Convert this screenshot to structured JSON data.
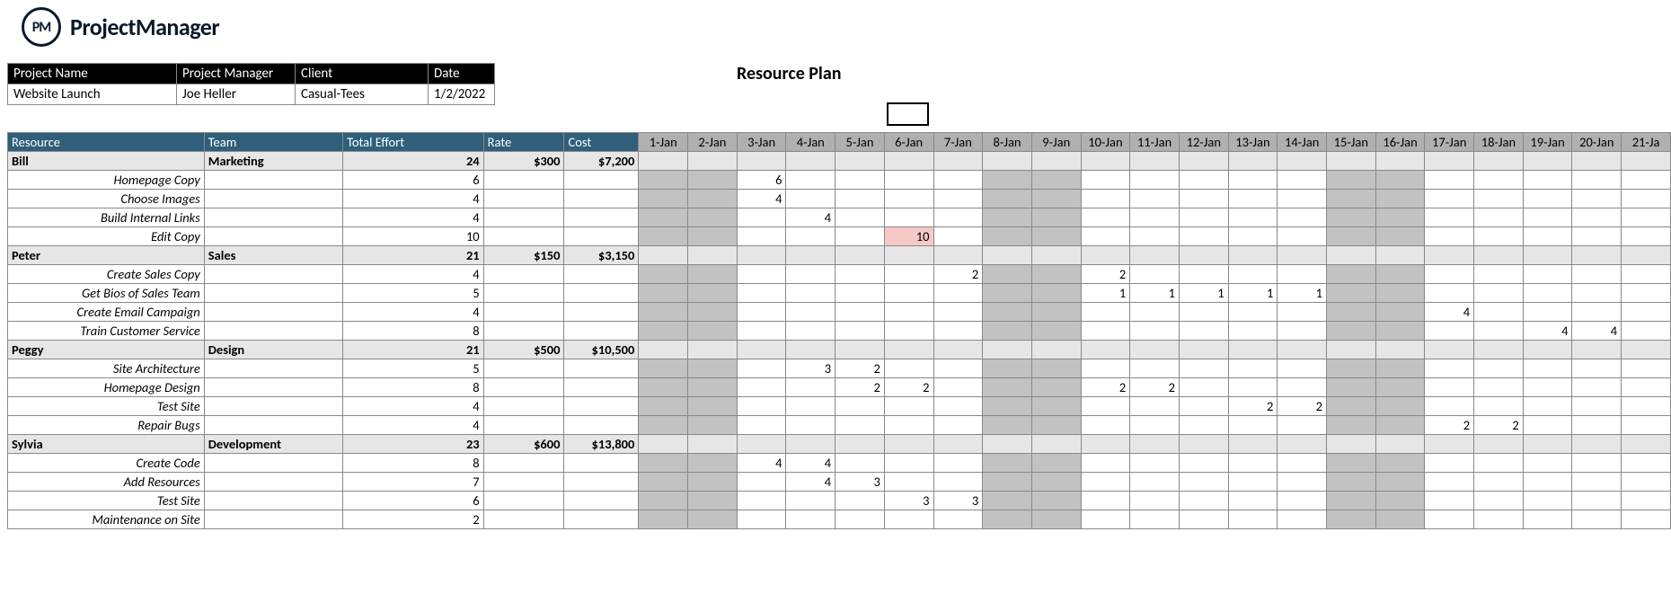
{
  "logo": {
    "badge": "PM",
    "name": "ProjectManager"
  },
  "title": "Resource Plan",
  "meta": {
    "headers": {
      "projectName": "Project Name",
      "projectManager": "Project Manager",
      "client": "Client",
      "date": "Date"
    },
    "values": {
      "projectName": "Website Launch",
      "projectManager": "Joe Heller",
      "client": "Casual-Tees",
      "date": "1/2/2022"
    }
  },
  "columns": {
    "resource": "Resource",
    "team": "Team",
    "totalEffort": "Total Effort",
    "rate": "Rate",
    "cost": "Cost"
  },
  "days": [
    "1-Jan",
    "2-Jan",
    "3-Jan",
    "4-Jan",
    "5-Jan",
    "6-Jan",
    "7-Jan",
    "8-Jan",
    "9-Jan",
    "10-Jan",
    "11-Jan",
    "12-Jan",
    "13-Jan",
    "14-Jan",
    "15-Jan",
    "16-Jan",
    "17-Jan",
    "18-Jan",
    "19-Jan",
    "20-Jan",
    "21-Ja"
  ],
  "shadedDayIdx": [
    0,
    1,
    7,
    8,
    14,
    15
  ],
  "groups": [
    {
      "resource": "Bill",
      "team": "Marketing",
      "totalEffort": "24",
      "rate": "$300",
      "cost": "$7,200",
      "tasks": [
        {
          "name": "Homepage Copy",
          "effort": "6",
          "cells": {
            "2": "6"
          }
        },
        {
          "name": "Choose Images",
          "effort": "4",
          "cells": {
            "2": "4"
          }
        },
        {
          "name": "Build Internal Links",
          "effort": "4",
          "cells": {
            "3": "4"
          }
        },
        {
          "name": "Edit Copy",
          "effort": "10",
          "cells": {
            "5": "10"
          },
          "warn": [
            5
          ]
        }
      ]
    },
    {
      "resource": "Peter",
      "team": "Sales",
      "totalEffort": "21",
      "rate": "$150",
      "cost": "$3,150",
      "tasks": [
        {
          "name": "Create Sales Copy",
          "effort": "4",
          "cells": {
            "6": "2",
            "9": "2"
          }
        },
        {
          "name": "Get Bios of Sales Team",
          "effort": "5",
          "cells": {
            "9": "1",
            "10": "1",
            "11": "1",
            "12": "1",
            "13": "1"
          }
        },
        {
          "name": "Create Email Campaign",
          "effort": "4",
          "cells": {
            "16": "4"
          }
        },
        {
          "name": "Train Customer Service",
          "effort": "8",
          "cells": {
            "18": "4",
            "19": "4"
          }
        }
      ]
    },
    {
      "resource": "Peggy",
      "team": "Design",
      "totalEffort": "21",
      "rate": "$500",
      "cost": "$10,500",
      "tasks": [
        {
          "name": "Site Architecture",
          "effort": "5",
          "cells": {
            "3": "3",
            "4": "2"
          }
        },
        {
          "name": "Homepage Design",
          "effort": "8",
          "cells": {
            "4": "2",
            "5": "2",
            "9": "2",
            "10": "2"
          }
        },
        {
          "name": "Test Site",
          "effort": "4",
          "cells": {
            "12": "2",
            "13": "2"
          }
        },
        {
          "name": "Repair Bugs",
          "effort": "4",
          "cells": {
            "16": "2",
            "17": "2"
          }
        }
      ]
    },
    {
      "resource": "Sylvia",
      "team": "Development",
      "totalEffort": "23",
      "rate": "$600",
      "cost": "$13,800",
      "tasks": [
        {
          "name": "Create Code",
          "effort": "8",
          "cells": {
            "2": "4",
            "3": "4"
          }
        },
        {
          "name": "Add Resources",
          "effort": "7",
          "cells": {
            "3": "4",
            "4": "3"
          }
        },
        {
          "name": "Test Site",
          "effort": "6",
          "cells": {
            "5": "3",
            "6": "3"
          }
        },
        {
          "name": "Maintenance on Site",
          "effort": "2",
          "cells": {}
        }
      ]
    }
  ]
}
